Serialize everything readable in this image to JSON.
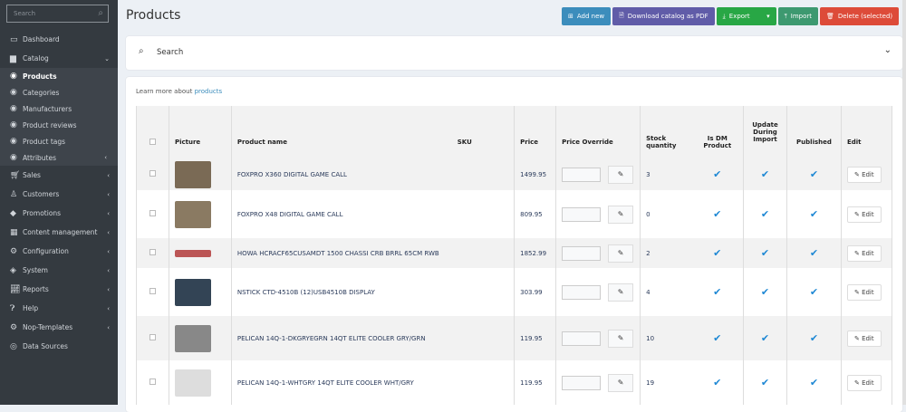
{
  "sidebar": {
    "search_placeholder": "Search",
    "items": [
      {
        "label": "Dashboard",
        "icon": "monitor-icon"
      },
      {
        "label": "Catalog",
        "icon": "book-icon",
        "expanded": true,
        "children": [
          {
            "label": "Products",
            "active": true
          },
          {
            "label": "Categories"
          },
          {
            "label": "Manufacturers"
          },
          {
            "label": "Product reviews"
          },
          {
            "label": "Product tags"
          },
          {
            "label": "Attributes"
          }
        ]
      },
      {
        "label": "Sales",
        "icon": "cart-icon"
      },
      {
        "label": "Customers",
        "icon": "user-icon"
      },
      {
        "label": "Promotions",
        "icon": "tag-icon"
      },
      {
        "label": "Content management",
        "icon": "cubes-icon"
      },
      {
        "label": "Configuration",
        "icon": "gears-icon"
      },
      {
        "label": "System",
        "icon": "cube-icon"
      },
      {
        "label": "Reports",
        "icon": "chart-icon"
      },
      {
        "label": "Help",
        "icon": "question-icon"
      },
      {
        "label": "Nop-Templates",
        "icon": "gear-icon"
      },
      {
        "label": "Data Sources",
        "icon": "circle-icon"
      }
    ]
  },
  "header": {
    "title": "Products",
    "buttons": {
      "add": "Add new",
      "pdf": "Download catalog as PDF",
      "export": "Export",
      "import": "Import",
      "delete": "Delete (selected)"
    }
  },
  "colors": {
    "add": "#3c8dbc",
    "pdf": "#605ca8",
    "export": "#28a745",
    "import": "#3d9970",
    "delete": "#dd4b39"
  },
  "search": {
    "label": "Search"
  },
  "learn": {
    "prefix": "Learn more about",
    "link": "products"
  },
  "table": {
    "headers": {
      "picture": "Picture",
      "name": "Product name",
      "sku": "SKU",
      "price": "Price",
      "override": "Price Override",
      "stock": "Stock quantity",
      "isdm": "Is DM Product",
      "update": "Update During Import",
      "published": "Published",
      "edit": "Edit"
    },
    "edit_label": "Edit",
    "rows": [
      {
        "name": "FOXPRO X360 DIGITAL GAME CALL",
        "price": "1499.95",
        "stock": "3"
      },
      {
        "name": "FOXPRO X48 DIGITAL GAME CALL",
        "price": "809.95",
        "stock": "0"
      },
      {
        "name": "HOWA HCRACF65CUSAMDT 1500 CHASSI CRB BRRL 65CM RWB",
        "price": "1852.99",
        "stock": "2"
      },
      {
        "name": "NSTICK CTD-4510B (12)USB4510B DISPLAY",
        "price": "303.99",
        "stock": "4"
      },
      {
        "name": "PELICAN 14Q-1-DKGRYEGRN 14QT ELITE COOLER GRY/GRN",
        "price": "119.95",
        "stock": "10"
      },
      {
        "name": "PELICAN 14Q-1-WHTGRY 14QT ELITE COOLER WHT/GRY",
        "price": "119.95",
        "stock": "19"
      }
    ]
  }
}
